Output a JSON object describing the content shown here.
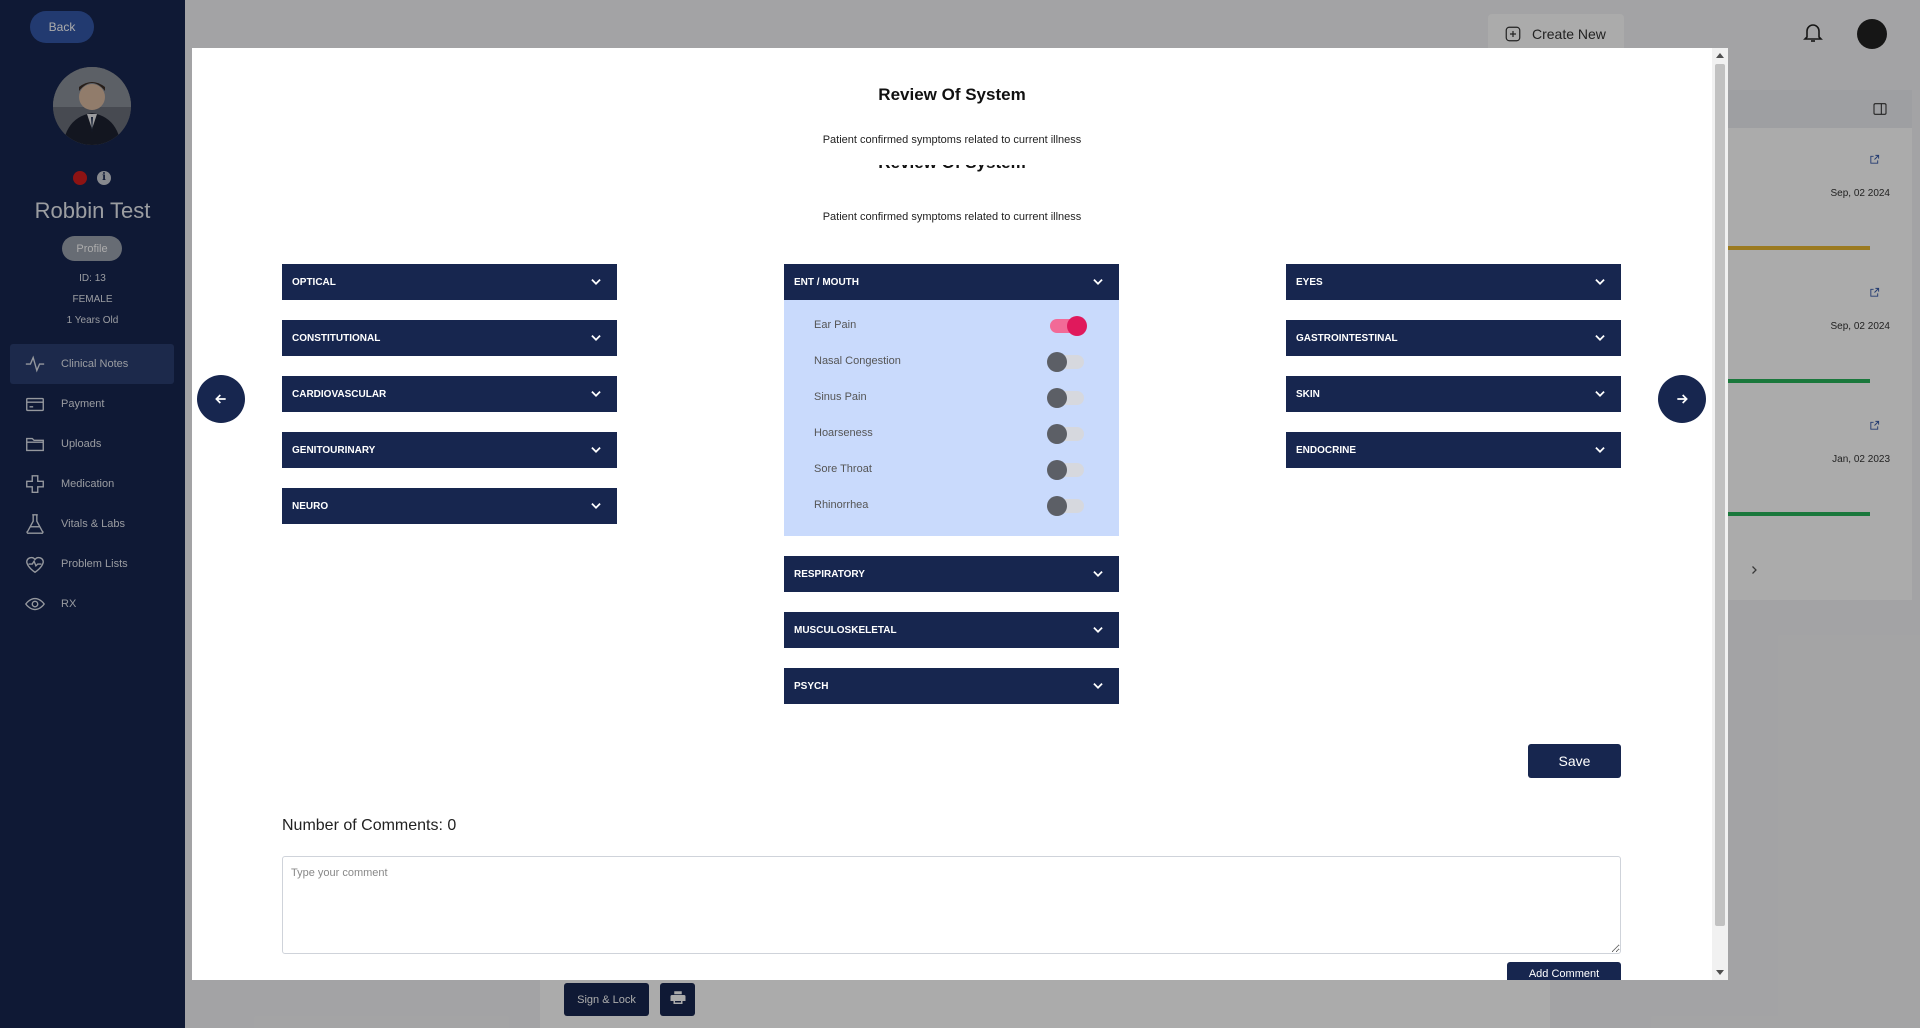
{
  "sidebar": {
    "back_label": "Back",
    "patient_name": "Robbin Test",
    "profile_label": "Profile",
    "id_text": "ID: 13",
    "gender": "FEMALE",
    "age": "1 Years Old",
    "status_color": "#d31d1d",
    "nav": [
      {
        "label": "Clinical Notes",
        "icon": "pulse-icon",
        "active": true
      },
      {
        "label": "Payment",
        "icon": "card-icon"
      },
      {
        "label": "Uploads",
        "icon": "folder-icon"
      },
      {
        "label": "Medication",
        "icon": "medical-cross-icon"
      },
      {
        "label": "Vitals & Labs",
        "icon": "flask-icon"
      },
      {
        "label": "Problem Lists",
        "icon": "heart-pulse-icon"
      },
      {
        "label": "RX",
        "icon": "eye-icon"
      }
    ]
  },
  "header": {
    "create_new_label": "Create New"
  },
  "right_panel": {
    "entries": [
      {
        "date": "Sep, 02 2024",
        "bar_color": "#e8b731"
      },
      {
        "date": "Sep, 02 2024",
        "bar_color": "#27b35a"
      },
      {
        "date": "Jan, 02 2023",
        "bar_color": "#27b35a"
      }
    ]
  },
  "footer": {
    "sign_lock_label": "Sign & Lock"
  },
  "modal": {
    "title": "Review Of System",
    "subtitle": "Patient confirmed symptoms related to current illness",
    "subtitle_2": "Patient confirmed symptoms related to current illness",
    "left_sections": [
      "OPTICAL",
      "CONSTITUTIONAL",
      "CARDIOVASCULAR",
      "GENITOURINARY",
      "NEURO"
    ],
    "center_top_section": "ENT / MOUTH",
    "ent_symptoms": [
      {
        "label": "Ear Pain",
        "checked": true
      },
      {
        "label": "Nasal Congestion",
        "checked": false
      },
      {
        "label": "Sinus Pain",
        "checked": false
      },
      {
        "label": "Hoarseness",
        "checked": false
      },
      {
        "label": "Sore Throat",
        "checked": false
      },
      {
        "label": "Rhinorrhea",
        "checked": false
      }
    ],
    "center_bottom_sections": [
      "RESPIRATORY",
      "MUSCULOSKELETAL",
      "PSYCH"
    ],
    "right_sections": [
      "EYES",
      "GASTROINTESTINAL",
      "SKIN",
      "ENDOCRINE"
    ],
    "save_label": "Save",
    "comments_count_label": "Number of Comments: 0",
    "comment_placeholder": "Type your comment",
    "add_comment_label": "Add Comment",
    "accent_color": "#17264f",
    "expanded_bg": "#c9dafc",
    "toggle_on_color": "#e0195c"
  }
}
